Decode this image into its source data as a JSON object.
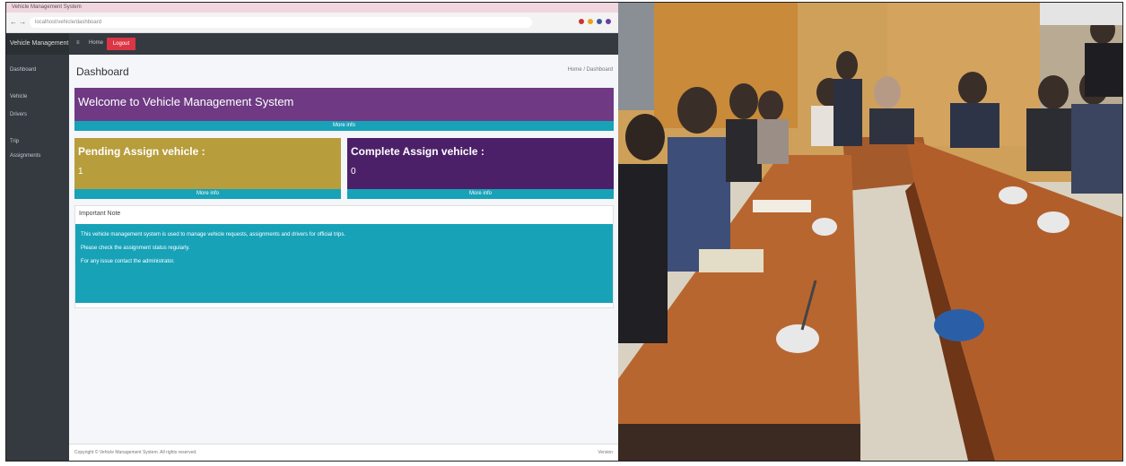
{
  "browser": {
    "tab_title": "Vehicle Management System",
    "url": "localhost/vehicle/dashboard"
  },
  "sidebar": {
    "brand": "Vehicle Management",
    "items": [
      {
        "label": "Dashboard"
      },
      {
        "label": "Vehicle"
      },
      {
        "label": "Drivers"
      },
      {
        "label": "Trip"
      },
      {
        "label": "Assignments"
      }
    ]
  },
  "navbar": {
    "links": [
      "≡",
      "Home"
    ],
    "logout": "Logout"
  },
  "content": {
    "header": "Dashboard",
    "breadcrumb": "Home / Dashboard"
  },
  "welcome": {
    "title": "Welcome to Vehicle Management System",
    "footer": "More info"
  },
  "stats": {
    "pending": {
      "title": "Pending Assign vehicle :",
      "value": "1",
      "footer": "More info"
    },
    "complete": {
      "title": "Complete Assign vehicle :",
      "value": "0",
      "footer": "More info"
    }
  },
  "card": {
    "header": "Important Note",
    "lines": [
      "This vehicle management system is used to manage vehicle requests, assignments and drivers for official trips.",
      "Please check the assignment status regularly.",
      "For any issue contact the administrator."
    ]
  },
  "footer": {
    "left": "Copyright © Vehicle Management System. All rights reserved.",
    "right": "Version"
  },
  "colors": {
    "welcome": "#6f3a83",
    "pending": "#b89d3c",
    "complete": "#4c2069",
    "info": "#17a2b8",
    "sidebar": "#343a40"
  }
}
